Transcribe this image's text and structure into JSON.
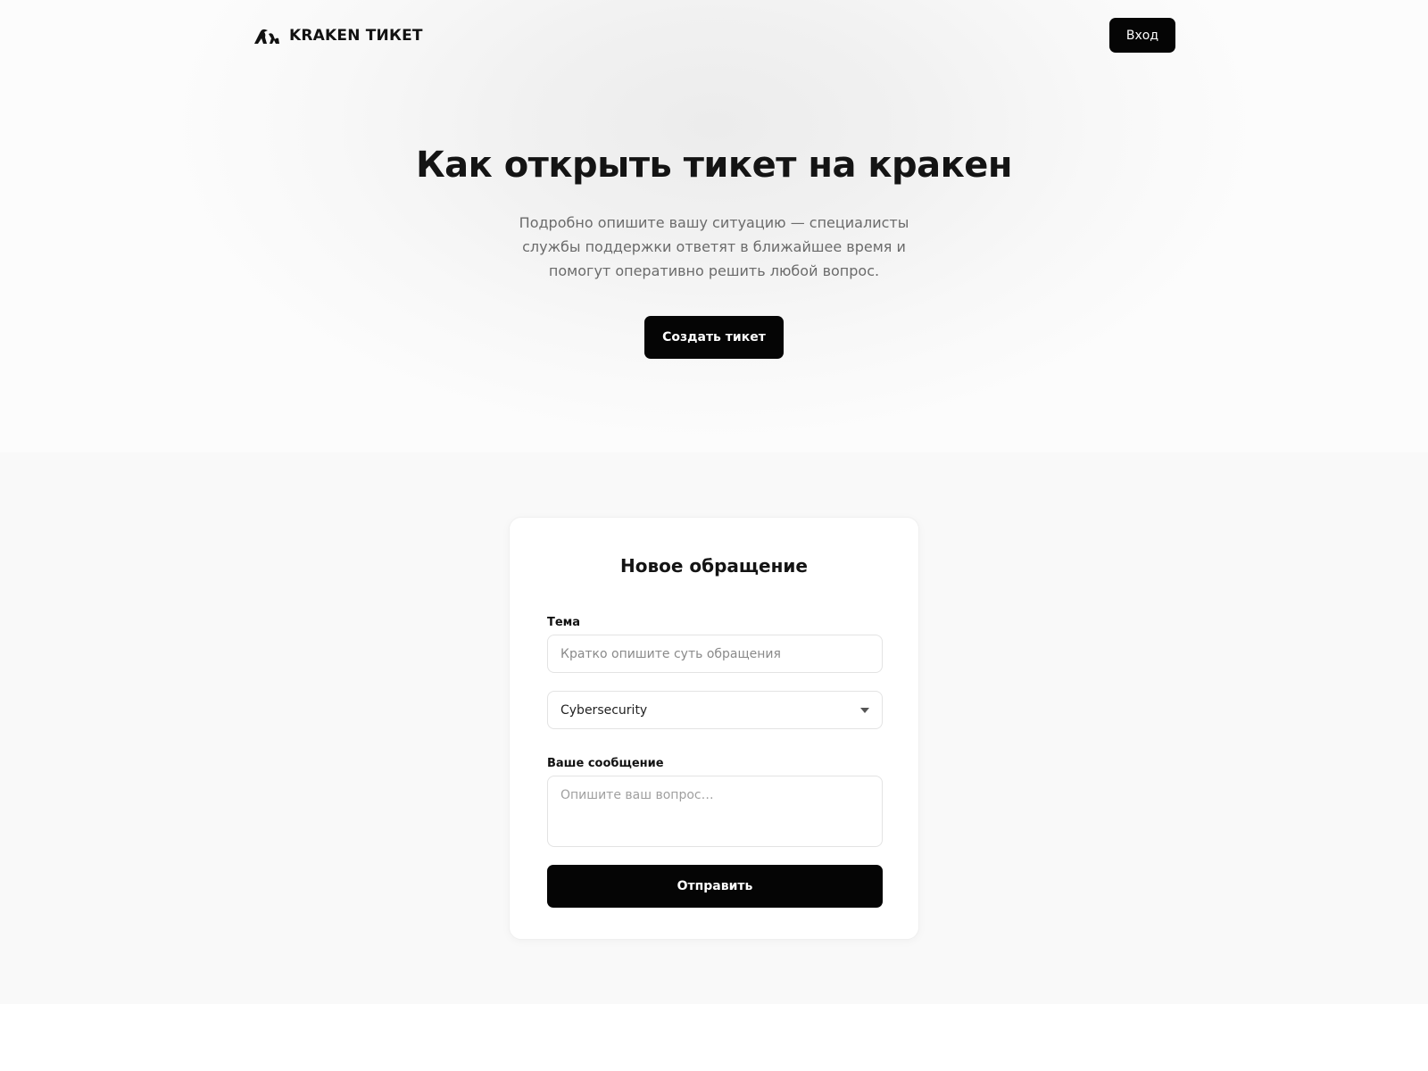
{
  "header": {
    "logo_icon": "kraken-logo-icon",
    "logo_text": "KRAKEN ТИКЕТ",
    "login_label": "Вход"
  },
  "hero": {
    "title": "Как открыть тикет на кракен",
    "subtitle": "Подробно опишите вашу ситуацию — специалисты службы поддержки ответят в ближайшее время и помогут оперативно решить любой вопрос.",
    "cta_label": "Создать тикет"
  },
  "form": {
    "title": "Новое обращение",
    "topic_label": "Тема",
    "topic_placeholder": "Кратко опишите суть обращения",
    "topic_value": "",
    "category_selected": "Cybersecurity",
    "message_label": "Ваше сообщение",
    "message_placeholder": "Опишите ваш вопрос…",
    "message_value": "",
    "submit_label": "Отправить"
  },
  "colors": {
    "primary_button": "#050505",
    "page_text": "#111111",
    "muted_text": "#6b6b6b",
    "section_background": "#f9f9f9"
  }
}
